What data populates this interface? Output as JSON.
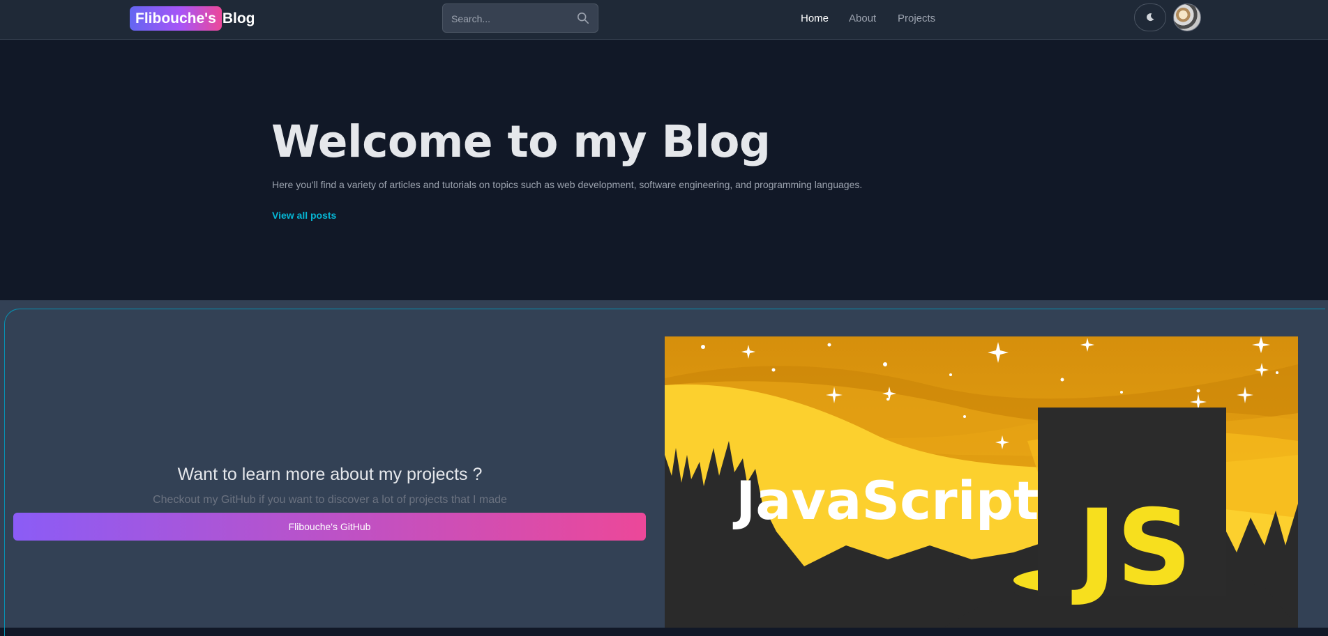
{
  "nav": {
    "brand_badge": "Flibouche's",
    "brand_rest": "Blog",
    "search_placeholder": "Search...",
    "links": [
      {
        "label": "Home",
        "active": true
      },
      {
        "label": "About",
        "active": false
      },
      {
        "label": "Projects",
        "active": false
      }
    ],
    "theme_icon": "moon-icon",
    "avatar_icon": "avatar"
  },
  "hero": {
    "title": "Welcome to my Blog",
    "description": "Here you'll find a variety of articles and tutorials on topics such as web development, software engineering, and programming languages.",
    "link_label": "View all posts"
  },
  "projects": {
    "title": "Want to learn more about my projects ?",
    "subtitle": "Checkout my GitHub if you want to discover a lot of projects that I made",
    "button_label": "Flibouche's GitHub",
    "banner": {
      "word": "JavaScript",
      "badge": "JS"
    }
  },
  "colors": {
    "page_bg": "#111827",
    "nav_bg": "#1f2937",
    "section_bg": "#334155",
    "accent_cyan": "#06b6d4",
    "gradient_start": "#8b5cf6",
    "gradient_end": "#ec4899",
    "js_yellow": "#f7df1e"
  }
}
